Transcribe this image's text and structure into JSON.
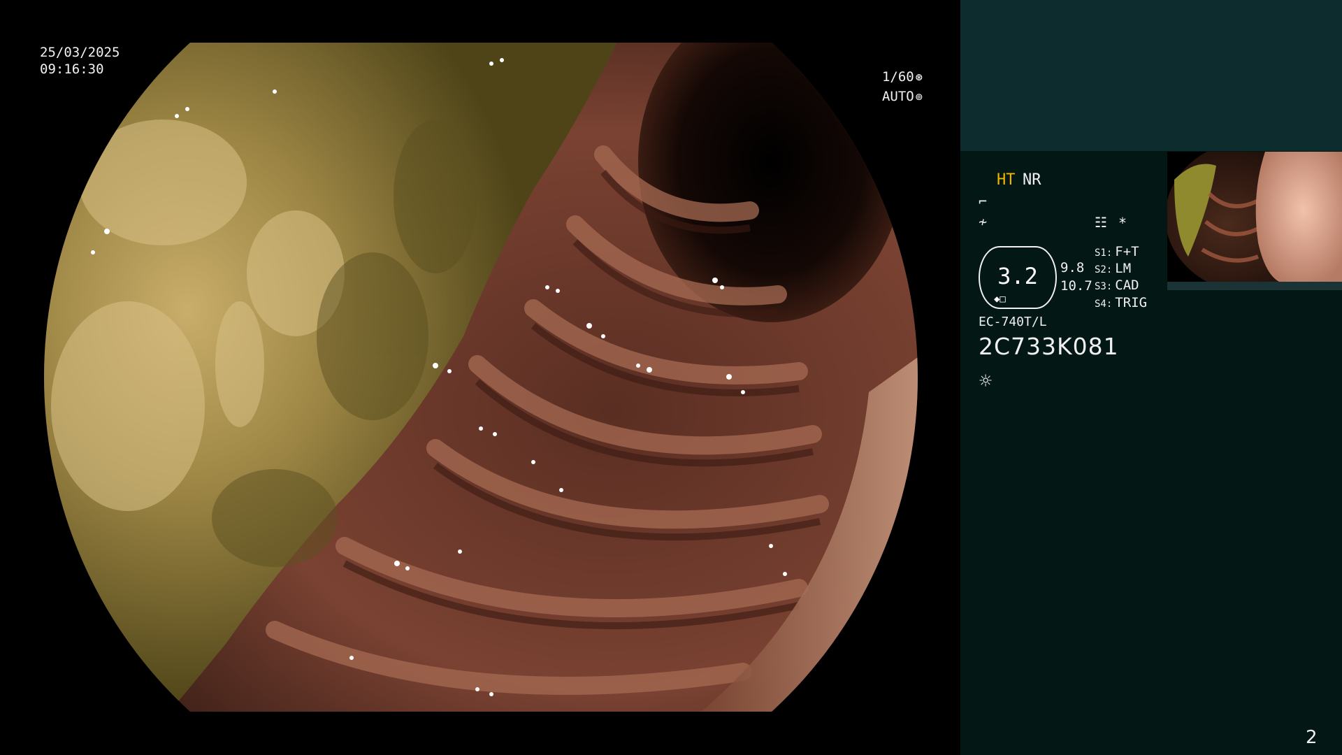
{
  "osd": {
    "date": "25/03/2025",
    "time": "09:16:30",
    "shutter": "1/60",
    "exposure": "AUTO"
  },
  "panel": {
    "mode_ht": "HT",
    "mode_nr": "NR",
    "zoom": "3.2",
    "lens_a": "9.8",
    "lens_b": "10.7",
    "settings": [
      {
        "key": "S1:",
        "value": "F+T"
      },
      {
        "key": "S2:",
        "value": "LM"
      },
      {
        "key": "S3:",
        "value": "CAD"
      },
      {
        "key": "S4:",
        "value": "TRIG"
      }
    ],
    "scope_model": "EC-740T/L",
    "scope_serial": "2C733K081",
    "asterisk": "*",
    "page_number": "2"
  },
  "icons": {
    "shutter": "aperture-icon",
    "exposure": "auto-exposure-icon",
    "mode_1": "enhancement-curve-icon",
    "mode_2": "frequency-icon",
    "settings": "settings-list-icon",
    "light": "light-source-icon"
  },
  "colors": {
    "panel_bg": "#031715",
    "panel_header_bg": "#0d2c2e",
    "accent_ht": "#f2b400"
  }
}
